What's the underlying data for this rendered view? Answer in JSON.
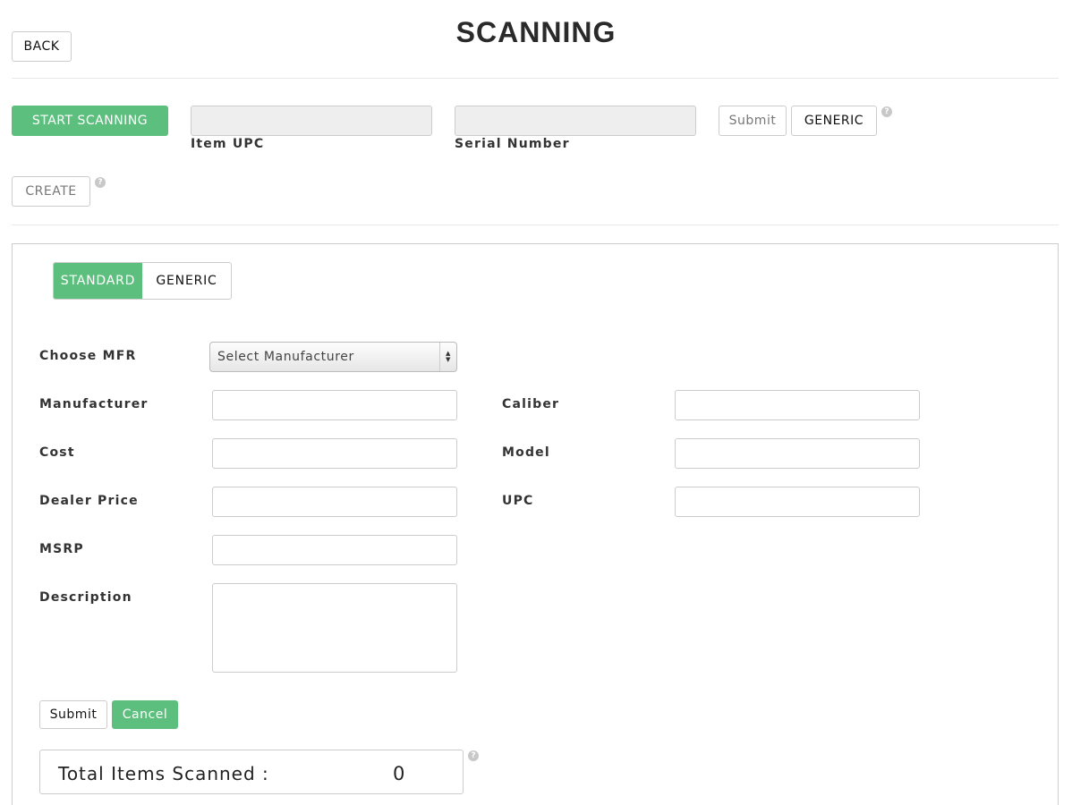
{
  "header": {
    "title": "SCANNING",
    "back_label": "BACK"
  },
  "scan_bar": {
    "start_label": "START SCANNING",
    "item_upc_label": "Item UPC",
    "item_upc_value": "",
    "serial_label": "Serial Number",
    "serial_value": "",
    "submit_label": "Submit",
    "generic_label": "GENERIC",
    "create_label": "CREATE",
    "help_glyph": "?"
  },
  "form": {
    "tabs": [
      {
        "label": "STANDARD",
        "active": true
      },
      {
        "label": "GENERIC",
        "active": false
      }
    ],
    "choose_mfr_label": "Choose MFR",
    "choose_mfr_selected": "Select Manufacturer",
    "fields": {
      "manufacturer": {
        "label": "Manufacturer",
        "value": ""
      },
      "cost": {
        "label": "Cost",
        "value": ""
      },
      "dealer_price": {
        "label": "Dealer Price",
        "value": ""
      },
      "msrp": {
        "label": "MSRP",
        "value": ""
      },
      "description": {
        "label": "Description",
        "value": ""
      },
      "caliber": {
        "label": "Caliber",
        "value": ""
      },
      "model": {
        "label": "Model",
        "value": ""
      },
      "upc": {
        "label": "UPC",
        "value": ""
      }
    },
    "submit_label": "Submit",
    "cancel_label": "Cancel"
  },
  "totals": {
    "label": "Total Items Scanned :",
    "value": "0"
  },
  "colors": {
    "accent": "#5cbf7e",
    "border": "#cccccc",
    "disabled_input": "#eeeeee"
  }
}
